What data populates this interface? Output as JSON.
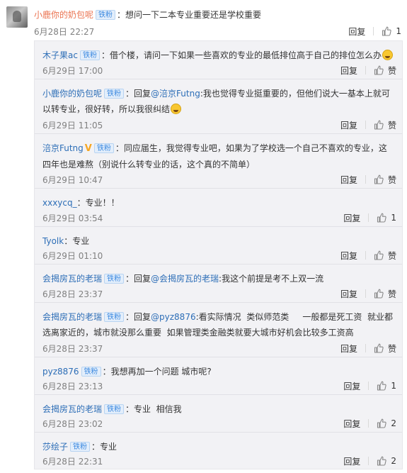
{
  "main_comment": {
    "user": "小鹿你的奶包呢",
    "badge": "铁粉",
    "text": "：想问一下二本专业重要还是学校重要",
    "time": "6月28日 22:27",
    "reply_label": "回复",
    "likes": "1"
  },
  "replies": [
    {
      "user": "木子果ac",
      "badge": "铁粉",
      "text": "：借个楼，请问一下如果一些喜欢的专业的最低排位高于自己的排位怎么办",
      "time": "6月29日 17:00",
      "reply_label": "回复",
      "likes": "赞",
      "emoji": "grinning-sweat-emoji"
    },
    {
      "user": "小鹿你的奶包呢",
      "badge": "铁粉",
      "prefix": "：回复",
      "mention": "@涪京Futng",
      "text": ":我也觉得专业挺重要的，但他们说大一基本上就可以转专业，很好转，所以我很纠结",
      "time": "6月29日 11:05",
      "reply_label": "回复",
      "likes": "赞",
      "emoji": "crying-emoji"
    },
    {
      "user": "涪京Futng",
      "verified": "V",
      "badge": "铁粉",
      "text": "：同应届生，我觉得专业吧，如果为了学校选一个自己不喜欢的专业，这四年也是难熬（别说什么转专业的话，这个真的不简单）",
      "time": "6月29日 10:47",
      "reply_label": "回复",
      "likes": "赞"
    },
    {
      "user": "xxxycq_",
      "text": "：专业！！",
      "time": "6月29日 03:54",
      "reply_label": "回复",
      "likes": "1"
    },
    {
      "user": "Tyolk",
      "text": "：专业",
      "time": "6月29日 01:10",
      "reply_label": "回复",
      "likes": "赞"
    },
    {
      "user": "会揭房瓦的老瑞",
      "badge": "铁粉",
      "prefix": "：回复",
      "mention": "@会揭房瓦的老瑞",
      "text": ":我这个前提是考不上双一流",
      "time": "6月28日 23:37",
      "reply_label": "回复",
      "likes": "赞"
    },
    {
      "user": "会揭房瓦的老瑞",
      "badge": "铁粉",
      "prefix": "：回复",
      "mention": "@pyz8876",
      "text": ":看实际情况  类似师范类     一般都是死工资  就业都选离家近的，城市就没那么重要  如果管理类金融类就要大城市好机会比较多工资高",
      "time": "6月28日 23:37",
      "reply_label": "回复",
      "likes": "赞"
    },
    {
      "user": "pyz8876",
      "badge": "铁粉",
      "text": "：我想再加一个问题 城市呢?",
      "time": "6月28日 23:13",
      "reply_label": "回复",
      "likes": "1"
    },
    {
      "user": "会揭房瓦的老瑞",
      "badge": "铁粉",
      "text": "：专业  相信我",
      "time": "6月28日 23:02",
      "reply_label": "回复",
      "likes": "2"
    },
    {
      "user": "莎绘子",
      "badge": "铁粉",
      "text": "：专业",
      "time": "6月28日 22:31",
      "reply_label": "回复",
      "likes": "2"
    }
  ],
  "colors": {
    "username": "#2d6eb7",
    "main_username": "#eb7350",
    "panel_bg": "#f2f2f5",
    "badge_bg": "#e3eefb",
    "muted": "#808080"
  }
}
